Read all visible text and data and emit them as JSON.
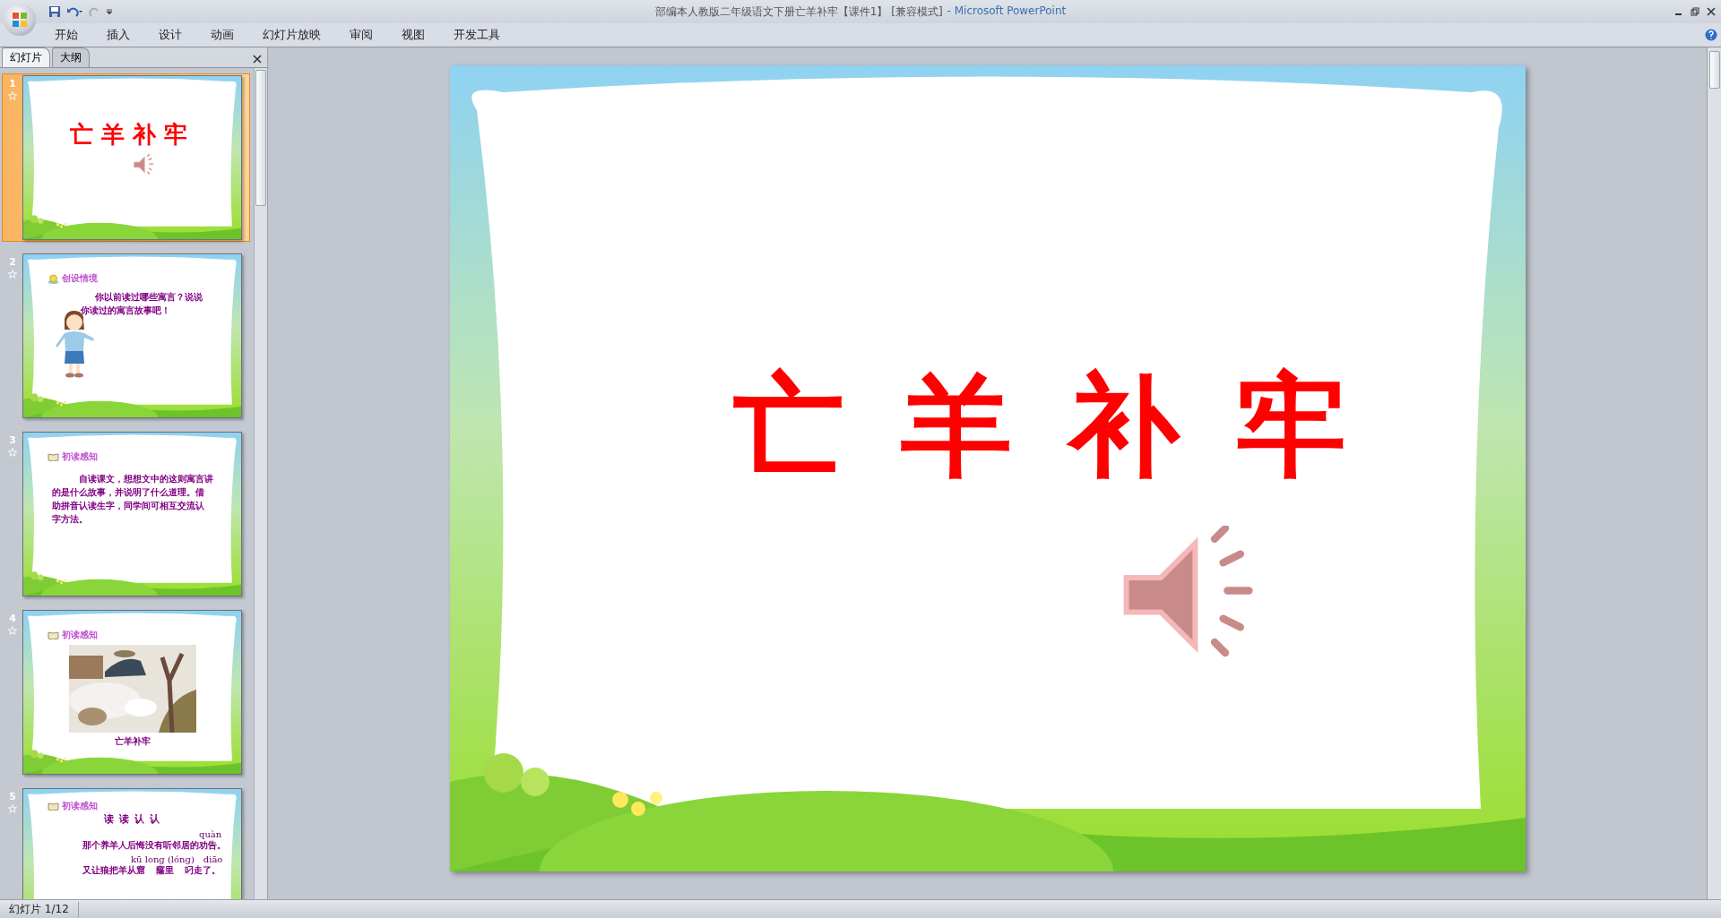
{
  "window": {
    "title": "部编本人教版二年级语文下册亡羊补牢【课件1】 [兼容模式]",
    "app": "- Microsoft PowerPoint"
  },
  "ribbon_tabs": [
    {
      "label": "开始",
      "selected": false
    },
    {
      "label": "插入",
      "selected": false
    },
    {
      "label": "设计",
      "selected": false
    },
    {
      "label": "动画",
      "selected": false
    },
    {
      "label": "幻灯片放映",
      "selected": false
    },
    {
      "label": "审阅",
      "selected": false
    },
    {
      "label": "视图",
      "selected": false
    },
    {
      "label": "开发工具",
      "selected": false
    }
  ],
  "panel_tabs": [
    {
      "label": "幻灯片",
      "selected": true
    },
    {
      "label": "大纲",
      "selected": false
    }
  ],
  "thumbnails": [
    {
      "number": "1",
      "selected": true,
      "kind": "title",
      "title": "亡 羊 补 牢"
    },
    {
      "number": "2",
      "selected": false,
      "kind": "scene",
      "heading": "创设情境",
      "lines": [
        "你以前读过哪些寓言？说说",
        "你读过的寓言故事吧！"
      ]
    },
    {
      "number": "3",
      "selected": false,
      "kind": "text",
      "heading": "初读感知",
      "lines": [
        "自读课文，想想文中的这则寓言讲",
        "的是什么故事，并说明了什么道理。借",
        "助拼音认读生字，同学间可相互交流认",
        "字方法。"
      ]
    },
    {
      "number": "4",
      "selected": false,
      "kind": "picture",
      "heading": "初读感知",
      "caption": "亡羊补牢"
    },
    {
      "number": "5",
      "selected": false,
      "kind": "reading",
      "heading": "初读感知",
      "subtitle": "读 读 认 认",
      "rows": [
        {
          "kind": "pinyin",
          "parts": [
            "quàn"
          ]
        },
        {
          "kind": "sentence",
          "parts": [
            "那个养羊人后悔没有听邻居的劝告。"
          ]
        },
        {
          "kind": "pinyin",
          "parts": [
            "kū long (lóng)",
            "diāo"
          ]
        },
        {
          "kind": "sentence",
          "parts": [
            "又让狼把羊从窟",
            "窿里",
            "叼走了。"
          ]
        }
      ]
    }
  ],
  "slide": {
    "title": "亡 羊 补 牢"
  },
  "status_bar": {
    "text": "幻灯片 1/12"
  }
}
